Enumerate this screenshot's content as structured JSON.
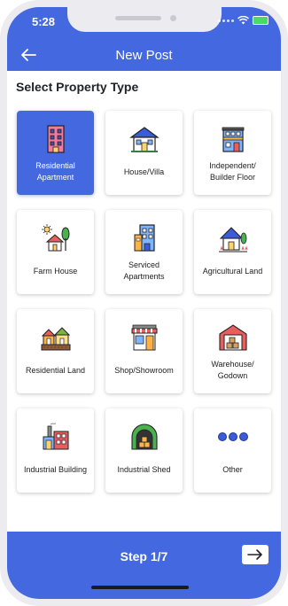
{
  "status_bar": {
    "time": "5:28"
  },
  "header": {
    "title": "New Post",
    "back_icon": "back-arrow-icon"
  },
  "section_title": "Select Property Type",
  "property_types": [
    {
      "label": "Residential Apartment",
      "icon": "apartment-building-icon",
      "selected": true
    },
    {
      "label": "House/Villa",
      "icon": "house-villa-icon",
      "selected": false
    },
    {
      "label": "Independent/ Builder Floor",
      "icon": "builder-floor-icon",
      "selected": false
    },
    {
      "label": "Farm House",
      "icon": "farm-house-icon",
      "selected": false
    },
    {
      "label": "Serviced Apartments",
      "icon": "serviced-apartment-icon",
      "selected": false
    },
    {
      "label": "Agricultural Land",
      "icon": "agricultural-land-icon",
      "selected": false
    },
    {
      "label": "Residential Land",
      "icon": "residential-land-icon",
      "selected": false
    },
    {
      "label": "Shop/Showroom",
      "icon": "shop-icon",
      "selected": false
    },
    {
      "label": "Warehouse/ Godown",
      "icon": "warehouse-icon",
      "selected": false
    },
    {
      "label": "Industrial Building",
      "icon": "factory-icon",
      "selected": false
    },
    {
      "label": "Industrial Shed",
      "icon": "shed-icon",
      "selected": false
    },
    {
      "label": "Other",
      "icon": "more-dots-icon",
      "selected": false
    }
  ],
  "footer": {
    "step_label": "Step 1/7",
    "next_icon": "arrow-right-icon"
  },
  "colors": {
    "primary": "#4468e0",
    "text": "#22232a"
  }
}
